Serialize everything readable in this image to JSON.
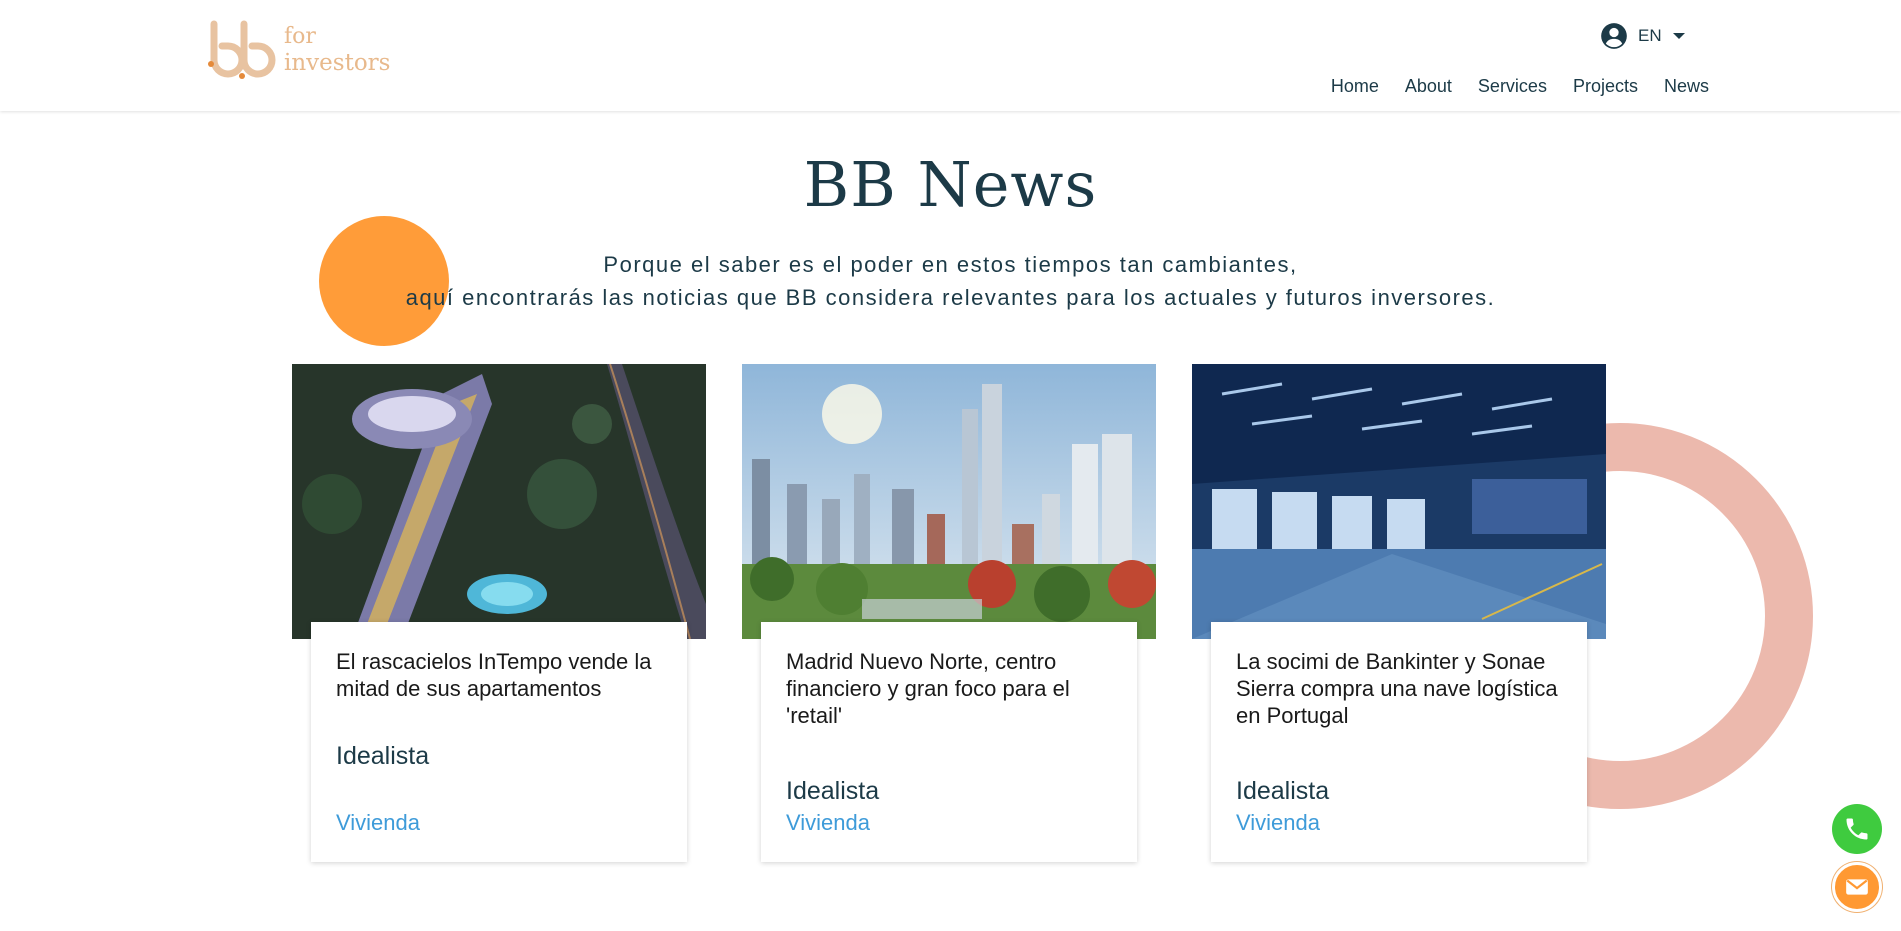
{
  "header": {
    "logo_line1": "for",
    "logo_line2": "investors",
    "language": "EN",
    "nav": [
      "Home",
      "About",
      "Services",
      "Projects",
      "News"
    ]
  },
  "main": {
    "title": "BB News",
    "subtitle_line1": "Porque el saber es el poder en estos tiempos tan cambiantes,",
    "subtitle_line2": "aquí encontrarás las noticias que BB considera relevantes para los actuales y futuros inversores."
  },
  "news": [
    {
      "headline": "El rascacielos InTempo vende la mitad de sus apartamentos",
      "source": "Idealista",
      "category": "Vivienda"
    },
    {
      "headline": "Madrid Nuevo Norte, centro financiero y gran foco para el 'retail'",
      "source": "Idealista",
      "category": "Vivienda"
    },
    {
      "headline": "La socimi de Bankinter y Sonae Sierra compra una nave logística en Portugal",
      "source": "Idealista",
      "category": "Vivienda"
    }
  ],
  "colors": {
    "accent_orange": "#ff9933",
    "ring_pink": "#ecb9ad",
    "text_dark": "#1c3a47",
    "link_blue": "#3e9bd9",
    "phone_green": "#3fcb3f"
  },
  "icons": {
    "user": "account-circle-icon",
    "dropdown": "caret-down-icon",
    "phone": "phone-icon",
    "mail": "mail-icon"
  }
}
